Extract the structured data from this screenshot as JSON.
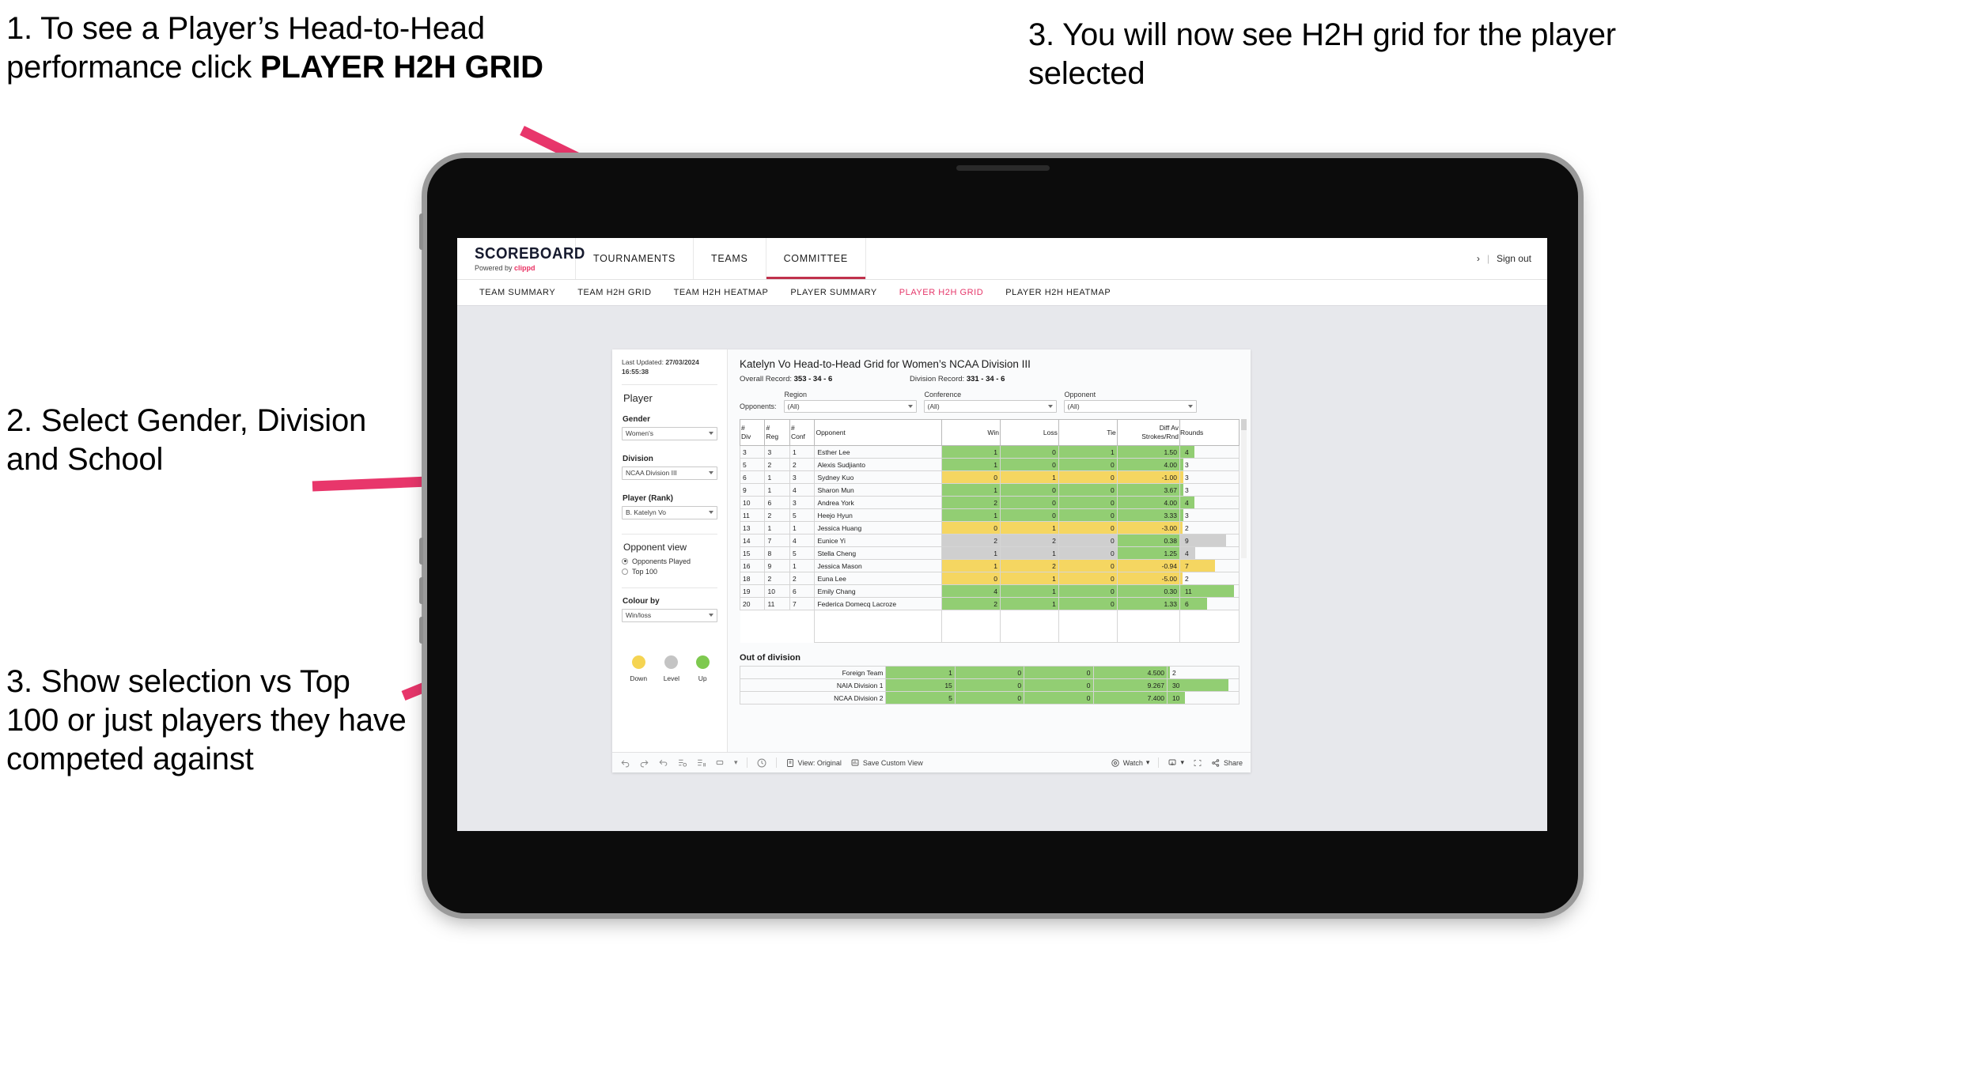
{
  "callouts": [
    {
      "id": "c1",
      "lead": "1. To see a Player’s Head-to-Head performance click ",
      "strong": "PLAYER H2H GRID"
    },
    {
      "id": "c2",
      "text": "2. Select Gender, Division and School"
    },
    {
      "id": "c3",
      "text": "3. Show selection vs Top 100 or just players they have competed against"
    },
    {
      "id": "c4",
      "text": "3. You will now see H2H grid for the player selected"
    }
  ],
  "colors": {
    "accent": "#e5376a",
    "brand_pink": "#ea2f62",
    "win_green": "#92ce73",
    "loss_yellow": "#f5d661",
    "level_grey": "#cfcfcf",
    "arrow": "#e8366b"
  },
  "app": {
    "brand": {
      "name": "SCOREBOARD",
      "powered_prefix": "Powered by ",
      "powered_brand": "clippd"
    },
    "top_nav": [
      {
        "label": "TOURNAMENTS",
        "active": false
      },
      {
        "label": "TEAMS",
        "active": false
      },
      {
        "label": "COMMITTEE",
        "active": true
      }
    ],
    "top_right": {
      "chevron": "›",
      "sep": "|",
      "sign_out": "Sign out"
    },
    "sub_nav": [
      {
        "label": "TEAM SUMMARY",
        "active": false
      },
      {
        "label": "TEAM H2H GRID",
        "active": false
      },
      {
        "label": "TEAM H2H HEATMAP",
        "active": false
      },
      {
        "label": "PLAYER SUMMARY",
        "active": false
      },
      {
        "label": "PLAYER H2H GRID",
        "active": true
      },
      {
        "label": "PLAYER H2H HEATMAP",
        "active": false
      }
    ]
  },
  "controls": {
    "last_updated_label": "Last Updated:",
    "last_updated_value": "27/03/2024",
    "last_updated_time": "16:55:38",
    "section_player": "Player",
    "gender_label": "Gender",
    "gender_value": "Women's",
    "division_label": "Division",
    "division_value": "NCAA Division III",
    "player_label": "Player (Rank)",
    "player_value": "B. Katelyn Vo",
    "opponent_view_label": "Opponent view",
    "opponent_options": [
      {
        "label": "Opponents Played",
        "selected": true
      },
      {
        "label": "Top 100",
        "selected": false
      }
    ],
    "colour_by_label": "Colour by",
    "colour_by_value": "Win/loss",
    "legend": [
      {
        "label": "Down",
        "color": "#f5d452"
      },
      {
        "label": "Level",
        "color": "#c4c4c4"
      },
      {
        "label": "Up",
        "color": "#7ec94f"
      }
    ]
  },
  "report": {
    "title": "Katelyn Vo Head-to-Head Grid for Women’s NCAA Division III",
    "overall_record_label": "Overall Record:",
    "overall_record_value": "353 - 34 - 6",
    "division_record_label": "Division Record:",
    "division_record_value": "331 - 34 - 6",
    "opponents_label": "Opponents:",
    "filters": [
      {
        "label": "Region",
        "value": "(All)"
      },
      {
        "label": "Conference",
        "value": "(All)"
      },
      {
        "label": "Opponent",
        "value": "(All)"
      }
    ],
    "out_of_division_title": "Out of division"
  },
  "chart_data": {
    "type": "table",
    "title": "Katelyn Vo Head-to-Head Grid for Women’s NCAA Division III",
    "columns": [
      "# Div",
      "# Reg",
      "# Conf",
      "Opponent",
      "Win",
      "Loss",
      "Tie",
      "Diff Av Strokes/Rnd",
      "Rounds"
    ],
    "column_header_lines": [
      [
        "#",
        "Div"
      ],
      [
        "#",
        "Reg"
      ],
      [
        "#",
        "Conf"
      ],
      [
        "Opponent"
      ],
      [
        "Win"
      ],
      [
        "Loss"
      ],
      [
        "Tie"
      ],
      [
        "Diff Av",
        "Strokes/Rnd"
      ],
      [
        "Rounds"
      ]
    ],
    "rows": [
      {
        "div": "3",
        "reg": "3",
        "conf": "1",
        "opponent": "Esther Lee",
        "win": "1",
        "loss": "0",
        "tie": "1",
        "diff": "1.50",
        "rounds": "4",
        "state": "up",
        "bar_pct": 24
      },
      {
        "div": "5",
        "reg": "2",
        "conf": "2",
        "opponent": "Alexis Sudjianto",
        "win": "1",
        "loss": "0",
        "tie": "0",
        "diff": "4.00",
        "rounds": "3",
        "state": "up",
        "bar_pct": 5
      },
      {
        "div": "6",
        "reg": "1",
        "conf": "3",
        "opponent": "Sydney Kuo",
        "win": "0",
        "loss": "1",
        "tie": "0",
        "diff": "-1.00",
        "rounds": "3",
        "state": "down",
        "bar_pct": 5
      },
      {
        "div": "9",
        "reg": "1",
        "conf": "4",
        "opponent": "Sharon Mun",
        "win": "1",
        "loss": "0",
        "tie": "0",
        "diff": "3.67",
        "rounds": "3",
        "state": "up",
        "bar_pct": 5
      },
      {
        "div": "10",
        "reg": "6",
        "conf": "3",
        "opponent": "Andrea York",
        "win": "2",
        "loss": "0",
        "tie": "0",
        "diff": "4.00",
        "rounds": "4",
        "state": "up",
        "bar_pct": 24
      },
      {
        "div": "11",
        "reg": "2",
        "conf": "5",
        "opponent": "Heejo Hyun",
        "win": "1",
        "loss": "0",
        "tie": "0",
        "diff": "3.33",
        "rounds": "3",
        "state": "up",
        "bar_pct": 5
      },
      {
        "div": "13",
        "reg": "1",
        "conf": "1",
        "opponent": "Jessica Huang",
        "win": "0",
        "loss": "1",
        "tie": "0",
        "diff": "-3.00",
        "rounds": "2",
        "state": "down",
        "bar_pct": 4
      },
      {
        "div": "14",
        "reg": "7",
        "conf": "4",
        "opponent": "Eunice Yi",
        "win": "2",
        "loss": "2",
        "tie": "0",
        "diff": "0.38",
        "rounds": "9",
        "state": "level",
        "bar_pct": 78
      },
      {
        "div": "15",
        "reg": "8",
        "conf": "5",
        "opponent": "Stella Cheng",
        "win": "1",
        "loss": "1",
        "tie": "0",
        "diff": "1.25",
        "rounds": "4",
        "state": "level",
        "bar_pct": 26
      },
      {
        "div": "16",
        "reg": "9",
        "conf": "1",
        "opponent": "Jessica Mason",
        "win": "1",
        "loss": "2",
        "tie": "0",
        "diff": "-0.94",
        "rounds": "7",
        "state": "down",
        "bar_pct": 60
      },
      {
        "div": "18",
        "reg": "2",
        "conf": "2",
        "opponent": "Euna Lee",
        "win": "0",
        "loss": "1",
        "tie": "0",
        "diff": "-5.00",
        "rounds": "2",
        "state": "down",
        "bar_pct": 4
      },
      {
        "div": "19",
        "reg": "10",
        "conf": "6",
        "opponent": "Emily Chang",
        "win": "4",
        "loss": "1",
        "tie": "0",
        "diff": "0.30",
        "rounds": "11",
        "state": "up",
        "bar_pct": 92
      },
      {
        "div": "20",
        "reg": "11",
        "conf": "7",
        "opponent": "Federica Domecq Lacroze",
        "win": "2",
        "loss": "1",
        "tie": "0",
        "diff": "1.33",
        "rounds": "6",
        "state": "up",
        "bar_pct": 46
      }
    ],
    "out_of_division_rows": [
      {
        "name": "Foreign Team",
        "win": "1",
        "loss": "0",
        "tie": "0",
        "diff": "4.500",
        "rounds": "2",
        "state": "up",
        "bar_pct": 3
      },
      {
        "name": "NAIA Division 1",
        "win": "15",
        "loss": "0",
        "tie": "0",
        "diff": "9.267",
        "rounds": "30",
        "state": "up",
        "bar_pct": 86
      },
      {
        "name": "NCAA Division 2",
        "win": "5",
        "loss": "0",
        "tie": "0",
        "diff": "7.400",
        "rounds": "10",
        "state": "up",
        "bar_pct": 24
      }
    ]
  },
  "workbook_toolbar": {
    "undo": "undo-icon",
    "redo": "redo-icon",
    "revert": "revert-icon",
    "refresh": "refresh-data-icon",
    "pause": "pause-icon",
    "shape": "shape-icon",
    "caret": "▾",
    "history": "history-icon",
    "view_label": "View: Original",
    "save_label": "Save Custom View",
    "watch_label": "Watch",
    "download_label": "download-icon",
    "fullscreen_label": "fullscreen-icon",
    "share_label": "Share"
  }
}
